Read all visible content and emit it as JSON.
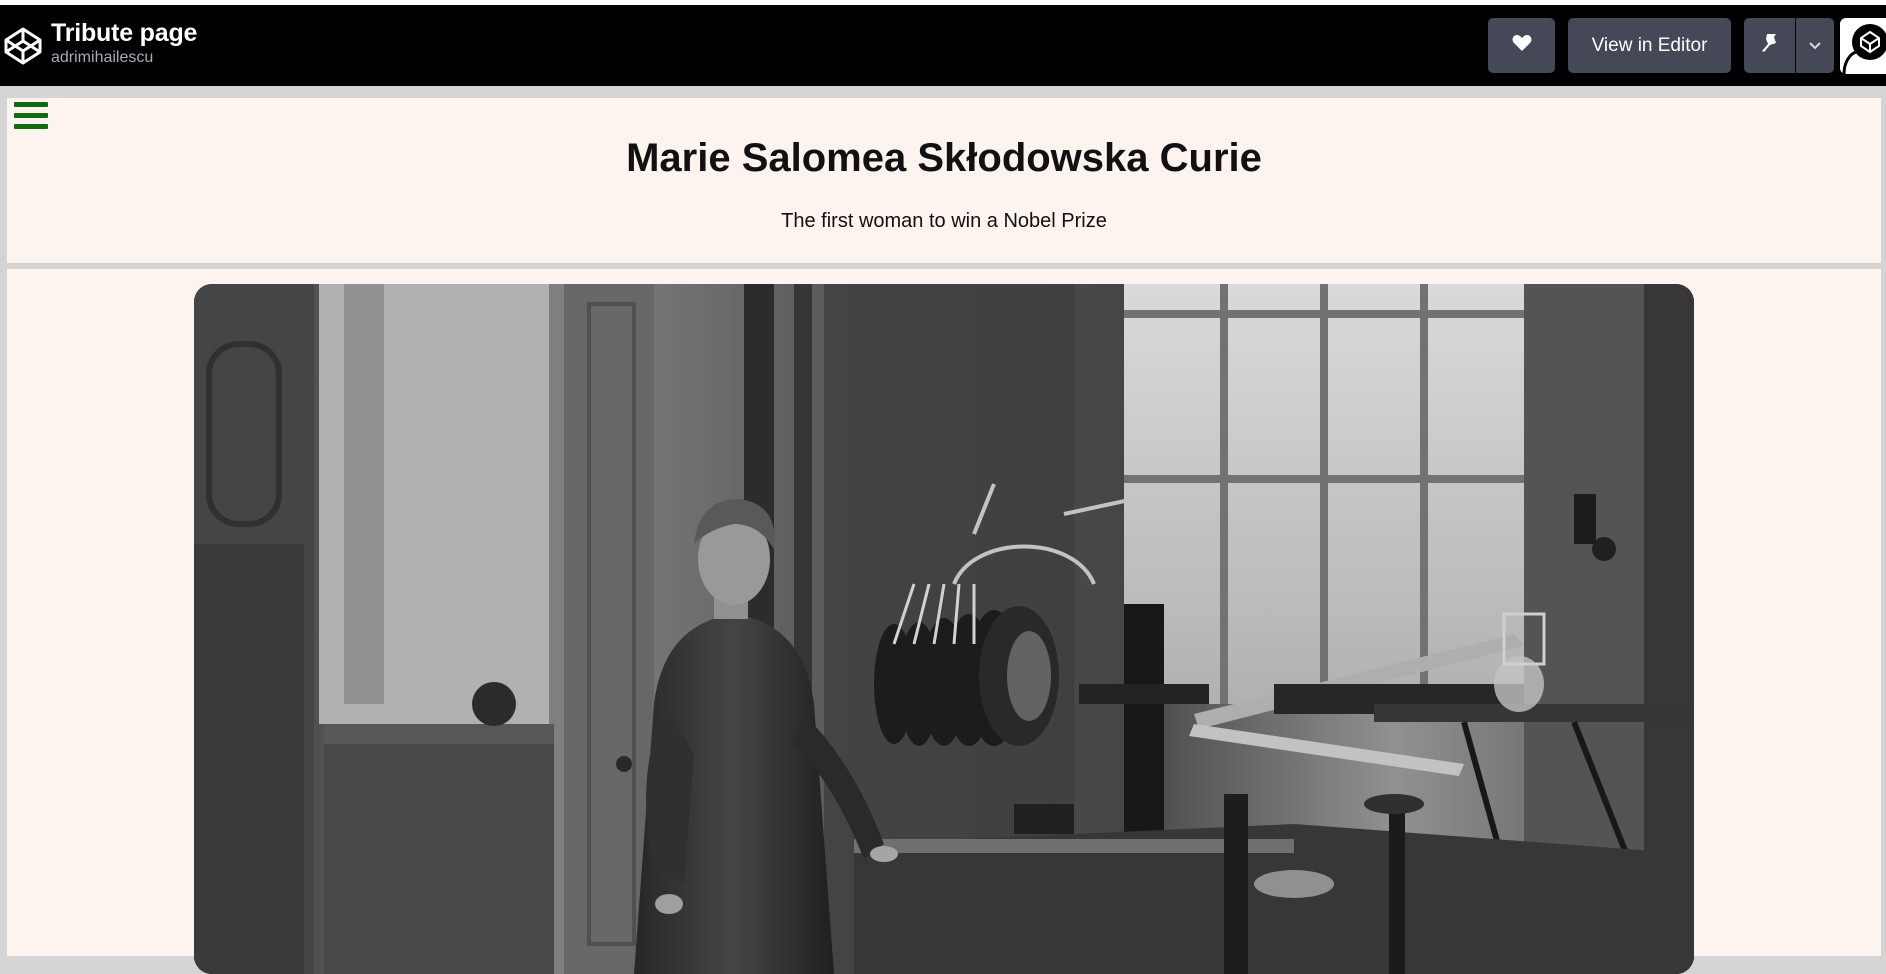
{
  "app": {
    "title": "Tribute page",
    "author": "adrimihailescu",
    "buttons": {
      "heart_icon": "heart-icon",
      "view_in_editor": "View in Editor",
      "pin_icon": "pin-icon",
      "chevron_icon": "chevron-down-icon"
    },
    "colors": {
      "header_bg": "#000000",
      "button_bg": "#444857",
      "page_bg": "#fdf4ef",
      "menu_icon": "#0f6a10"
    }
  },
  "tribute": {
    "menu_icon": "hamburger-menu-icon",
    "heading": "Marie Salomea Skłodowska Curie",
    "subheading": "The first woman to win a Nobel Prize",
    "image_subject": "black-and-white photo of Marie Curie standing in her laboratory"
  }
}
